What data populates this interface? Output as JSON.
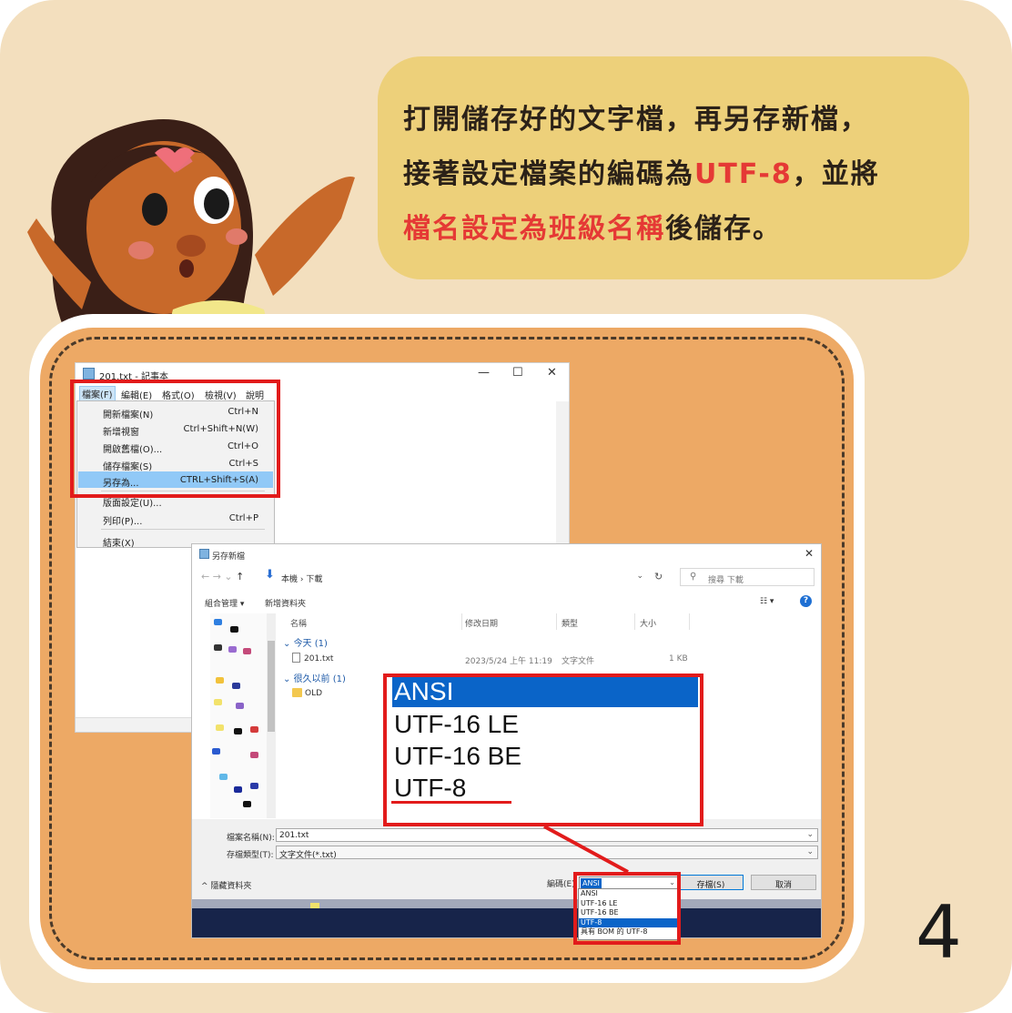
{
  "instruction": {
    "line1": "打開儲存好的文字檔，再另存新檔，",
    "line2_pre": "接著設定檔案的編碼為",
    "line2_red": "UTF-8",
    "line2_post": "，並將",
    "line3_red": "檔名設定為班級名稱",
    "line3_post": "後儲存。"
  },
  "step_number": "4",
  "notepad": {
    "title": "201.txt - 記事本",
    "menu": [
      "檔案(F)",
      "編輯(E)",
      "格式(O)",
      "檢視(V)",
      "說明"
    ],
    "file_menu": [
      {
        "label": "開新檔案(N)",
        "shortcut": "Ctrl+N"
      },
      {
        "label": "新增視窗",
        "shortcut": "Ctrl+Shift+N(W)"
      },
      {
        "label": "開啟舊檔(O)...",
        "shortcut": "Ctrl+O"
      },
      {
        "label": "儲存檔案(S)",
        "shortcut": "Ctrl+S"
      },
      {
        "label": "另存為...",
        "shortcut": "CTRL+Shift+S(A)"
      },
      {
        "label": "版面設定(U)...",
        "shortcut": ""
      },
      {
        "label": "列印(P)...",
        "shortcut": "Ctrl+P"
      },
      {
        "label": "結束(X)",
        "shortcut": ""
      }
    ],
    "window_buttons": {
      "minimize": "—",
      "maximize": "☐",
      "close": "✕"
    }
  },
  "save_dialog": {
    "title": "另存新檔",
    "path": "本機 › 下載",
    "search_placeholder": "搜尋 下載",
    "toolbar": {
      "organize": "組合管理 ▾",
      "new_folder": "新增資料夾"
    },
    "columns": [
      "名稱",
      "修改日期",
      "類型",
      "大小"
    ],
    "group_today": "今天 (1)",
    "group_old": "很久以前 (1)",
    "file": {
      "name": "201.txt",
      "date": "2023/5/24 上午 11:19",
      "type": "文字文件",
      "size": "1 KB"
    },
    "folder": {
      "name": "OLD"
    },
    "filename_label": "檔案名稱(N):",
    "filename_value": "201.txt",
    "filetype_label": "存檔類型(T):",
    "filetype_value": "文字文件(*.txt)",
    "hide_folders": "隱藏資料夾",
    "encoding_label": "編碼(E):",
    "encoding_value": "ANSI",
    "save_button": "存檔(S)",
    "cancel_button": "取消",
    "encoding_options": [
      "ANSI",
      "UTF-16 LE",
      "UTF-16 BE",
      "UTF-8",
      "具有 BOM 的 UTF-8"
    ],
    "encoding_selected": "UTF-8"
  },
  "zoom_options": [
    "ANSI",
    "UTF-16 LE",
    "UTF-16 BE",
    "UTF-8"
  ],
  "colors": {
    "accent_red": "#e21b1b",
    "highlight_blue": "#0a64c8",
    "bubble": "#edd07a",
    "card": "#eda965",
    "background": "#f3dfbe"
  }
}
